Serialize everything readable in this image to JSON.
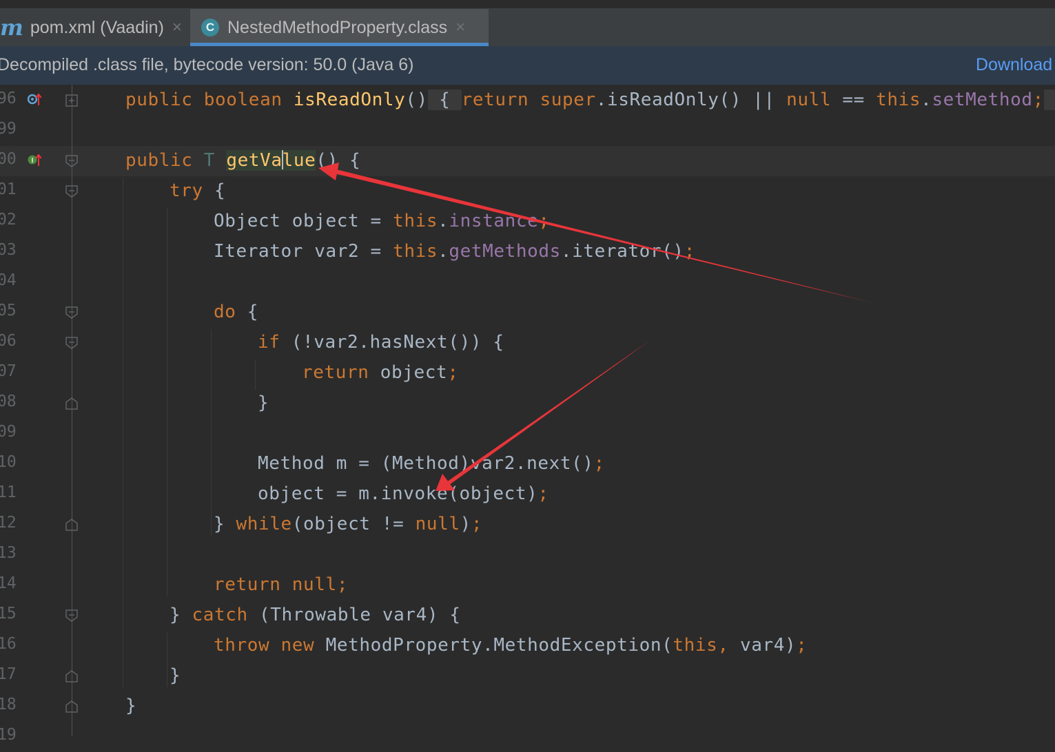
{
  "tabs": [
    {
      "icon": "maven-m-icon",
      "icon_glyph": "m",
      "label": "pom.xml (Vaadin)",
      "close": "×"
    },
    {
      "icon": "class-c-icon",
      "icon_glyph": "C",
      "label": "NestedMethodProperty.class",
      "close": "×",
      "active": true
    }
  ],
  "banner": {
    "text": "Decompiled .class file, bytecode version: 50.0 (Java 6)",
    "link": "Download"
  },
  "editor": {
    "lines": [
      {
        "num": "96",
        "gutter": "override-up-icon"
      },
      {
        "num": "99"
      },
      {
        "num": "00",
        "gutter": "implements-up-icon"
      },
      {
        "num": "01"
      },
      {
        "num": "02"
      },
      {
        "num": "03"
      },
      {
        "num": "04"
      },
      {
        "num": "05"
      },
      {
        "num": "06"
      },
      {
        "num": "07"
      },
      {
        "num": "08"
      },
      {
        "num": "09"
      },
      {
        "num": "10"
      },
      {
        "num": "11"
      },
      {
        "num": "12"
      },
      {
        "num": "13"
      },
      {
        "num": "14"
      },
      {
        "num": "15"
      },
      {
        "num": "16"
      },
      {
        "num": "17"
      },
      {
        "num": "18"
      },
      {
        "num": "19"
      }
    ],
    "tokens": {
      "l96": [
        "public",
        "boolean",
        "isReadOnly",
        "()",
        " { ",
        "return",
        "super",
        ".isReadOnly() || ",
        "null",
        " == ",
        "this",
        ".",
        "setMethod",
        ";",
        " }"
      ],
      "l00": [
        "public",
        "T",
        "getVa",
        "lue",
        "() {"
      ],
      "l01": [
        "try",
        " {"
      ],
      "l02": [
        "Object object = ",
        "this",
        ".",
        "instance",
        ";"
      ],
      "l03": [
        "Iterator var2 = ",
        "this",
        ".",
        "getMethods",
        ".iterator()",
        ";"
      ],
      "l05": [
        "do",
        " {"
      ],
      "l06": [
        "if",
        " (!var2.hasNext()) {"
      ],
      "l07": [
        "return",
        " object",
        ";"
      ],
      "l08": [
        "}"
      ],
      "l10": [
        "Method m = (Method)var2.next()",
        ";"
      ],
      "l11": [
        "object = m.invoke(object)",
        ";"
      ],
      "l12": [
        "} ",
        "while",
        "(object != ",
        "null",
        ")",
        ";"
      ],
      "l14": [
        "return",
        " ",
        "null",
        ";"
      ],
      "l15": [
        "} ",
        "catch",
        " (Throwable var4) {"
      ],
      "l16": [
        "throw",
        " ",
        "new",
        " MethodProperty.MethodException(",
        "this",
        ", ",
        "var4)",
        ";"
      ],
      "l17": [
        "}"
      ],
      "l18": [
        "}"
      ]
    }
  },
  "annotation_color": "#e8353a"
}
